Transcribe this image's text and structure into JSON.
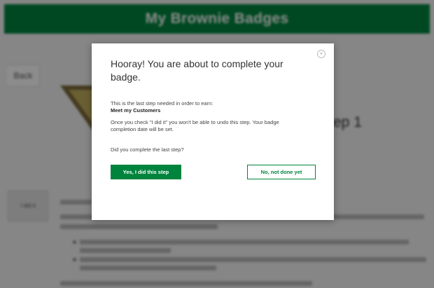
{
  "header": {
    "title": "My Brownie Badges"
  },
  "background": {
    "back_label": "Back",
    "step_heading": "ep 1",
    "step_button_label": "I did it"
  },
  "modal": {
    "close_icon": "×",
    "title": "Hooray! You are about to complete your badge.",
    "intro": "This is the last step needed in order to earn:",
    "badge_name": "Meet my Customers",
    "warning": "Once you check \"I did it\" you won't be able to undo this step. Your badge completion date will be set.",
    "question": "Did you complete the last step?",
    "yes_label": "Yes, I did this step",
    "no_label": "No, not done yet"
  },
  "colors": {
    "brand_green": "#00843d",
    "overlay": "rgba(0,0,0,0.45)"
  }
}
